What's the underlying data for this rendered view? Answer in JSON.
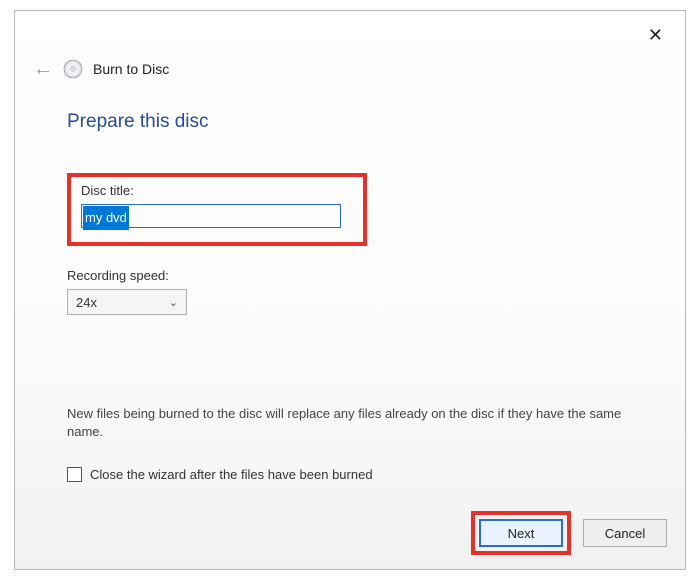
{
  "window": {
    "title": "Burn to Disc"
  },
  "main": {
    "heading": "Prepare this disc",
    "disc_title_label": "Disc title:",
    "disc_title_value": "my dvd",
    "recording_speed_label": "Recording speed:",
    "recording_speed_value": "24x",
    "note": "New files being burned to the disc will replace any files already on the disc if they have the same name.",
    "checkbox_label": "Close the wizard after the files have been burned",
    "checkbox_checked": false
  },
  "footer": {
    "next_label": "Next",
    "cancel_label": "Cancel"
  }
}
